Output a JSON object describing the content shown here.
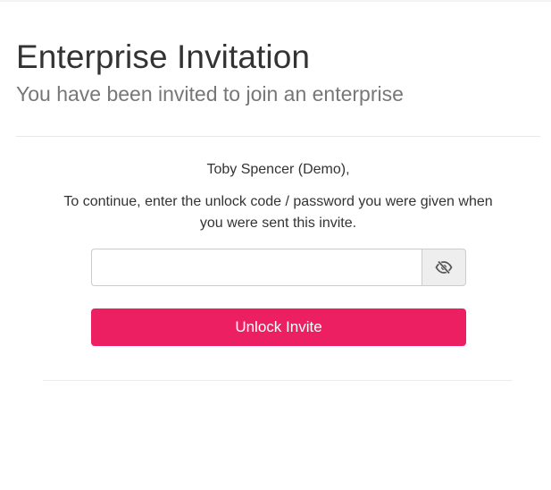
{
  "header": {
    "title": "Enterprise Invitation",
    "subtitle": "You have been invited to join an enterprise"
  },
  "invite": {
    "greeting": "Toby Spencer (Demo),",
    "instructions": "To continue, enter the unlock code / password you were given when you were sent this invite.",
    "password_value": "",
    "password_placeholder": "",
    "toggle_icon": "eye-slash-icon",
    "unlock_label": "Unlock Invite"
  },
  "colors": {
    "accent": "#ec1f63",
    "title_text": "#333333",
    "subtitle_text": "#777777",
    "toggle_bg": "#eeeeee"
  }
}
